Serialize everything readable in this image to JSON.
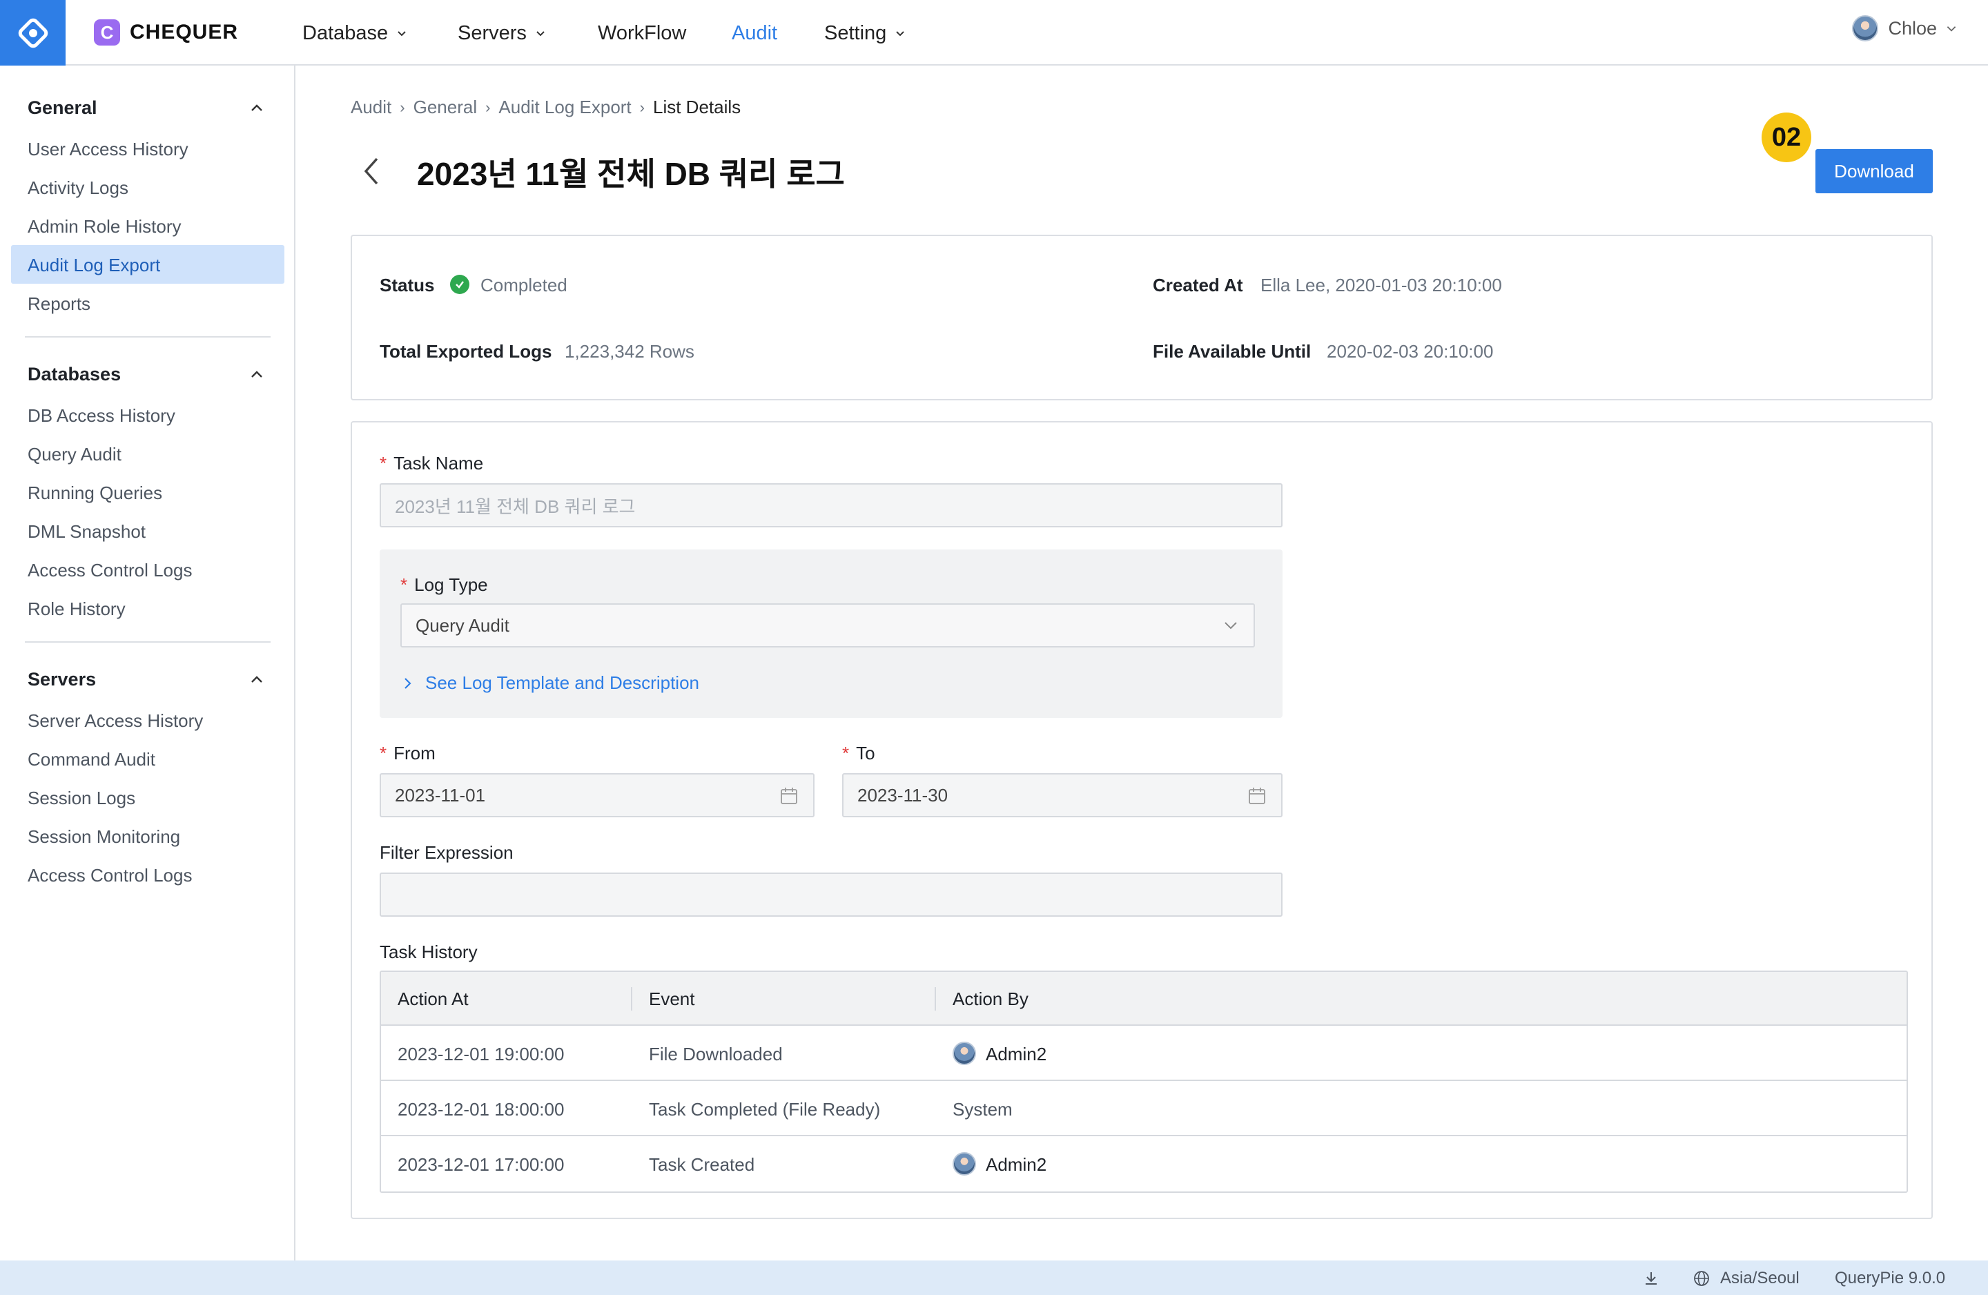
{
  "topbar": {
    "brand": "CHEQUER",
    "brand_mark": "C",
    "nav": [
      {
        "label": "Database",
        "has_caret": true
      },
      {
        "label": "Servers",
        "has_caret": true
      },
      {
        "label": "WorkFlow",
        "has_caret": false
      },
      {
        "label": "Audit",
        "has_caret": false,
        "active": true
      },
      {
        "label": "Setting",
        "has_caret": true
      }
    ],
    "user_name": "Chloe"
  },
  "sidebar": {
    "groups": [
      {
        "title": "General",
        "items": [
          "User Access History",
          "Activity Logs",
          "Admin Role History",
          "Audit Log Export",
          "Reports"
        ],
        "active_item": "Audit Log Export"
      },
      {
        "title": "Databases",
        "items": [
          "DB Access History",
          "Query Audit",
          "Running Queries",
          "DML Snapshot",
          "Access Control Logs",
          "Role History"
        ]
      },
      {
        "title": "Servers",
        "items": [
          "Server Access History",
          "Command Audit",
          "Session Logs",
          "Session Monitoring",
          "Access Control Logs"
        ]
      }
    ]
  },
  "breadcrumb": [
    "Audit",
    "General",
    "Audit Log Export",
    "List Details"
  ],
  "page": {
    "title": "2023년 11월 전체 DB 쿼리 로그",
    "step_badge": "02",
    "download_label": "Download"
  },
  "info": {
    "status_label": "Status",
    "status_value": "Completed",
    "created_label": "Created At",
    "created_value": "Ella Lee, 2020-01-03 20:10:00",
    "total_label": "Total Exported Logs",
    "total_value": "1,223,342 Rows",
    "available_label": "File Available Until",
    "available_value": "2020-02-03 20:10:00"
  },
  "form": {
    "required_mark": "*",
    "task_name_label": "Task Name",
    "task_name_value": "2023년 11월 전체 DB 쿼리 로그",
    "log_type_label": "Log Type",
    "log_type_value": "Query Audit",
    "template_link": "See Log Template and Description",
    "from_label": "From",
    "from_value": "2023-11-01",
    "to_label": "To",
    "to_value": "2023-11-30",
    "filter_label": "Filter Expression",
    "filter_value": ""
  },
  "history": {
    "title": "Task History",
    "columns": [
      "Action At",
      "Event",
      "Action By"
    ],
    "rows": [
      {
        "at": "2023-12-01 19:00:00",
        "event": "File Downloaded",
        "by": "Admin2",
        "avatar": true
      },
      {
        "at": "2023-12-01 18:00:00",
        "event": "Task Completed (File Ready)",
        "by": "System",
        "avatar": false
      },
      {
        "at": "2023-12-01 17:00:00",
        "event": "Task Created",
        "by": "Admin2",
        "avatar": true
      }
    ]
  },
  "statusbar": {
    "timezone": "Asia/Seoul",
    "version": "QueryPie 9.0.0"
  },
  "colors": {
    "accent": "#2e7ee6",
    "badge": "#f7c514",
    "success": "#2ea84f",
    "required": "#e03b3b",
    "brand_mark": "#9a6bf0"
  }
}
